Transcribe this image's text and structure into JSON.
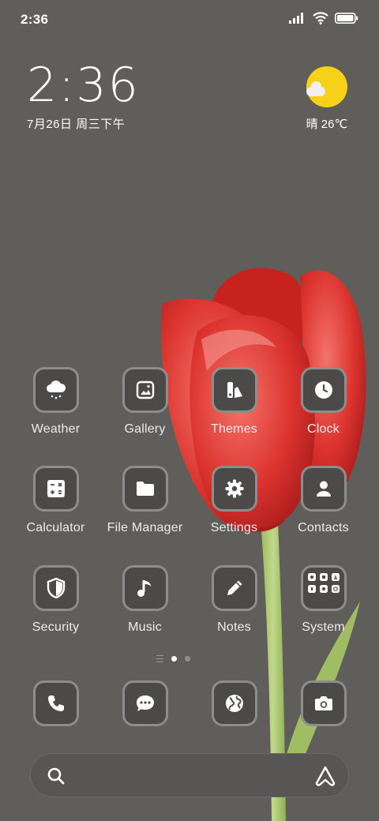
{
  "status_bar": {
    "time": "2:36",
    "icons": [
      "signal-icon",
      "wifi-icon",
      "battery-icon"
    ]
  },
  "clock_widget": {
    "time": "2:36",
    "date": "7月26日 周三下午"
  },
  "weather_widget": {
    "icon": "sun-cloud-icon",
    "text": "晴 26℃"
  },
  "apps": [
    {
      "label": "Weather",
      "icon": "weather-icon"
    },
    {
      "label": "Gallery",
      "icon": "gallery-icon"
    },
    {
      "label": "Themes",
      "icon": "themes-icon"
    },
    {
      "label": "Clock",
      "icon": "clock-icon"
    },
    {
      "label": "Calculator",
      "icon": "calculator-icon"
    },
    {
      "label": "File Manager",
      "icon": "folder-icon"
    },
    {
      "label": "Settings",
      "icon": "gear-icon"
    },
    {
      "label": "Contacts",
      "icon": "contact-icon"
    },
    {
      "label": "Security",
      "icon": "shield-icon"
    },
    {
      "label": "Music",
      "icon": "music-note-icon"
    },
    {
      "label": "Notes",
      "icon": "pencil-icon"
    },
    {
      "label": "System",
      "icon": "folder-grid-icon"
    }
  ],
  "page_indicator": {
    "pages": 2,
    "current": 1
  },
  "dock": [
    {
      "icon": "phone-icon"
    },
    {
      "icon": "message-icon"
    },
    {
      "icon": "browser-globe-icon"
    },
    {
      "icon": "camera-icon"
    }
  ],
  "search_bar": {
    "placeholder": "",
    "icons": [
      "search-icon",
      "assistant-icon"
    ]
  },
  "colors": {
    "background": "#5f5e5b",
    "tulip": "#d9302c",
    "stem": "#a6c46a",
    "sun": "#f6d117"
  }
}
